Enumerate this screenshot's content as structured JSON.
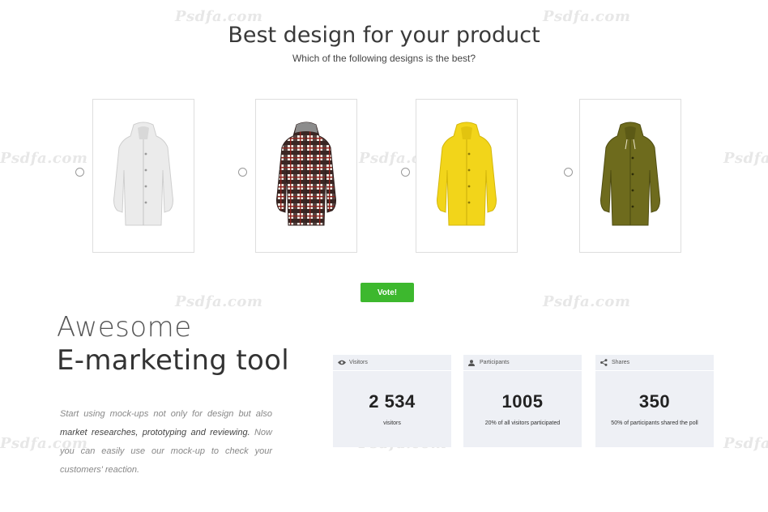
{
  "header": {
    "title": "Best design for your product",
    "subtitle": "Which of the following designs is the best?"
  },
  "poll": {
    "options": [
      {
        "name": "white-raincoat",
        "color": "#e6e6e6"
      },
      {
        "name": "plaid-raincoat",
        "color": "#5a3a34"
      },
      {
        "name": "yellow-raincoat",
        "color": "#f0d41a"
      },
      {
        "name": "olive-raincoat",
        "color": "#6d6a1c"
      }
    ],
    "vote_label": "Vote!"
  },
  "hero": {
    "line1": "Awesome",
    "line2": "E-marketing tool",
    "desc_part1": "Start using mock-ups not only for design but also ",
    "desc_bold": "market researches, prototyping and reviewing.",
    "desc_part2": " Now you can easily use our mock-up to check your customers' reaction."
  },
  "stats": [
    {
      "label": "Visitors",
      "icon": "eye-icon",
      "value": "2 534",
      "note": "visitors"
    },
    {
      "label": "Participants",
      "icon": "user-icon",
      "value": "1005",
      "note": "20% of all visitors participated"
    },
    {
      "label": "Shares",
      "icon": "share-icon",
      "value": "350",
      "note": "50% of participants shared the poll"
    }
  ],
  "watermark": {
    "text": "Psdfa.com"
  },
  "colors": {
    "accent": "#3db82e",
    "stat_bg": "#eef0f5"
  }
}
